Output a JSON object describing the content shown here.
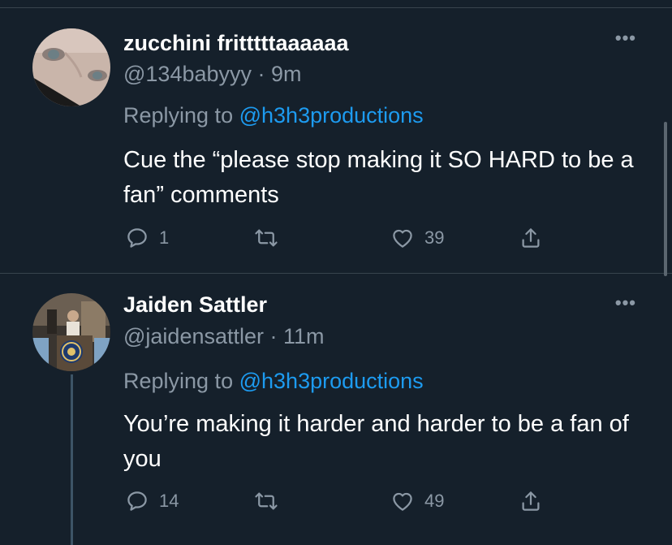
{
  "tweets": [
    {
      "name": "zucchini fritttttaaaaaa",
      "handle": "@134babyyy",
      "time": "9m",
      "replying_prefix": "Replying to",
      "replying_to": "@h3h3productions",
      "text": "Cue the “please stop making it SO HARD to be a fan” comments",
      "replies": "1",
      "retweets": "",
      "likes": "39",
      "more": "•••"
    },
    {
      "name": "Jaiden Sattler",
      "handle": "@jaidensattler",
      "time": "11m",
      "replying_prefix": "Replying to",
      "replying_to": "@h3h3productions",
      "text": "You’re making it harder and harder to be a fan of you",
      "replies": "14",
      "retweets": "",
      "likes": "49",
      "more": "•••"
    }
  ],
  "separator": " · ",
  "colors": {
    "background": "#15202b",
    "secondary_text": "#8b98a5",
    "link": "#1d9bf0",
    "divider": "#38444d"
  },
  "icons": [
    "reply-icon",
    "retweet-icon",
    "like-icon",
    "share-icon",
    "more-icon"
  ]
}
